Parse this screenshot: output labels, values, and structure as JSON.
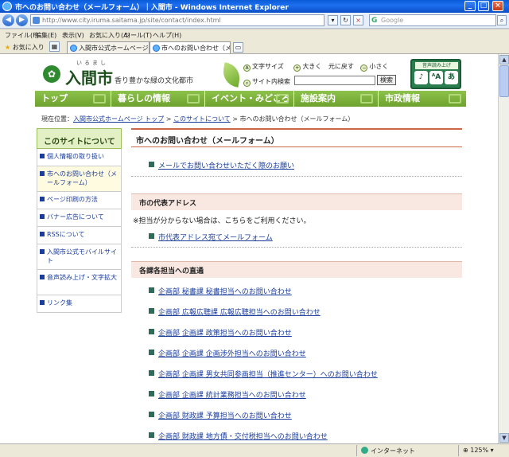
{
  "window": {
    "title": "市へのお問い合わせ（メールフォーム）｜入間市 - Windows Internet Explorer",
    "minimize": "_",
    "maximize": "□",
    "close": "×"
  },
  "addressbar": {
    "back": "◀",
    "forward": "▶",
    "url": "http://www.city.iruma.saitama.jp/site/contact/index.html",
    "refresh": "↻",
    "stop": "×",
    "search_placeholder": "Google"
  },
  "menubar": [
    "ファイル(F)",
    "編集(E)",
    "表示(V)",
    "お気に入り(A)",
    "ツール(T)",
    "ヘルプ(H)"
  ],
  "favorites": {
    "label": "お気に入り"
  },
  "tabs": [
    {
      "label": "入間市公式ホームページ トッ...",
      "active": false
    },
    {
      "label": "市へのお問い合わせ（メー...",
      "active": true,
      "close": "×"
    }
  ],
  "site": {
    "logo_ruby": "いるまし",
    "logo_text": "入間市",
    "logo_mark": "✿",
    "catchphrase": "香り豊かな緑の文化都市",
    "text_size_label": "文字サイズ",
    "text_size_options": [
      "大きく",
      "元に戻す",
      "小さく"
    ],
    "site_search_label": "サイト内検索",
    "search_button": "検索",
    "voice_label": "音声読み上げ",
    "voice_icons": [
      "♪",
      "ᴬA",
      "あ"
    ]
  },
  "gnav": [
    {
      "label": "トップ"
    },
    {
      "label": "暮らしの情報"
    },
    {
      "label": "イベント・みどころ"
    },
    {
      "label": "施設案内"
    },
    {
      "label": "市政情報"
    }
  ],
  "breadcrumb": {
    "prefix": "現在位置：",
    "items": [
      "入間市公式ホームページ トップ",
      "このサイトについて"
    ],
    "separator": " > ",
    "current": "市へのお問い合わせ（メールフォーム）"
  },
  "sidebar": {
    "title": "このサイトについて",
    "items": [
      {
        "label": "個人情報の取り扱い",
        "current": false
      },
      {
        "label": "市へのお問い合わせ（メールフォーム）",
        "current": true
      },
      {
        "label": "ページ印刷の方法",
        "current": false
      },
      {
        "label": "バナー広告について",
        "current": false
      },
      {
        "label": "RSSについて",
        "current": false
      },
      {
        "label": "入間市公式モバイルサイト",
        "current": false
      },
      {
        "label": "音声読み上げ・文字拡大",
        "current": false
      },
      {
        "label": "リンク集",
        "current": false
      }
    ]
  },
  "main": {
    "title": "市へのお問い合わせ（メールフォーム）",
    "intro_link": "メールでお問い合わせいただく際のお願い",
    "section1": {
      "heading": "市の代表アドレス",
      "note": "※担当が分からない場合は、こちらをご利用ください。",
      "link": "市代表アドレス宛てメールフォーム"
    },
    "section2": {
      "heading": "各課各担当への直通",
      "links": [
        "企画部 秘書課 秘書担当へのお問い合わせ",
        "企画部 広報広聴課 広報広聴担当へのお問い合わせ",
        "企画部 企画課 政策担当へのお問い合わせ",
        "企画部 企画課 企画渉外担当へのお問い合わせ",
        "企画部 企画課 男女共同参画担当（推進センター）へのお問い合わせ",
        "企画部 企画課 統計業務担当へのお問い合わせ",
        "企画部 財政課 予算担当へのお問い合わせ",
        "企画部 財政課 地方債・交付税担当へのお問い合わせ"
      ]
    }
  },
  "statusbar": {
    "zone": "インターネット",
    "zoom": "125%"
  }
}
